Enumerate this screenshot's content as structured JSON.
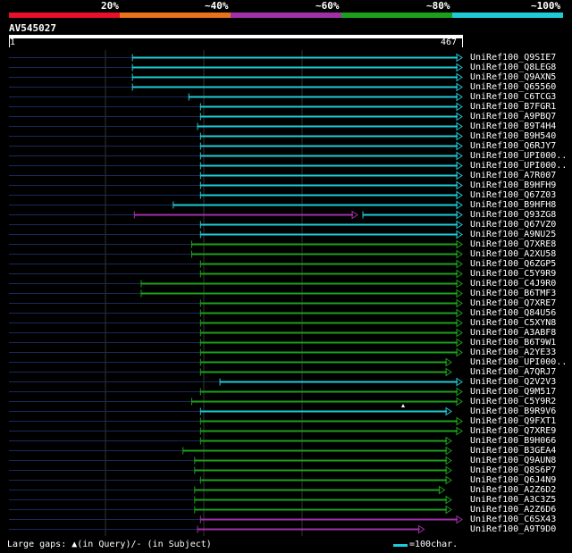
{
  "header": {
    "percent_labels": [
      "20%",
      "~40%",
      "~60%",
      "~80%",
      "~100%"
    ],
    "color_scale": [
      "#e8102a",
      "#e8731a",
      "#a030a8",
      "#1ca01c",
      "#1ecbd6"
    ]
  },
  "query": {
    "title": "AV545027",
    "start": "1",
    "end": "467"
  },
  "footer": {
    "legend": "Large gaps: ▲(in Query)/- (in Subject)",
    "scale_label": "=100char."
  },
  "hits": [
    {
      "label": "UniRef100_Q9SIE7",
      "start": 128,
      "end": 467,
      "color": "cyan"
    },
    {
      "label": "UniRef100_Q8LEG8",
      "start": 128,
      "end": 467,
      "color": "cyan"
    },
    {
      "label": "UniRef100_Q9AXN5",
      "start": 128,
      "end": 467,
      "color": "cyan"
    },
    {
      "label": "UniRef100_Q65560",
      "start": 128,
      "end": 467,
      "color": "cyan"
    },
    {
      "label": "UniRef100_C6TCG3",
      "start": 186,
      "end": 467,
      "color": "cyan"
    },
    {
      "label": "UniRef100_B7FGR1",
      "start": 198,
      "end": 467,
      "color": "cyan"
    },
    {
      "label": "UniRef100_A9PBQ7",
      "start": 198,
      "end": 467,
      "color": "cyan"
    },
    {
      "label": "UniRef100_B9T4H4",
      "start": 195,
      "end": 467,
      "color": "cyan"
    },
    {
      "label": "UniRef100_B9H540",
      "start": 198,
      "end": 467,
      "color": "cyan"
    },
    {
      "label": "UniRef100_Q6RJY7",
      "start": 198,
      "end": 467,
      "color": "cyan"
    },
    {
      "label": "UniRef100_UPI000..",
      "start": 198,
      "end": 467,
      "color": "cyan"
    },
    {
      "label": "UniRef100_UPI000..",
      "start": 198,
      "end": 467,
      "color": "cyan"
    },
    {
      "label": "UniRef100_A7R007",
      "start": 198,
      "end": 467,
      "color": "cyan"
    },
    {
      "label": "UniRef100_B9HFH9",
      "start": 198,
      "end": 467,
      "color": "cyan"
    },
    {
      "label": "UniRef100_Q67Z03",
      "start": 198,
      "end": 467,
      "color": "cyan"
    },
    {
      "label": "UniRef100_B9HFH8",
      "start": 170,
      "end": 467,
      "color": "cyan"
    },
    {
      "label": "UniRef100_Q93ZG8",
      "start": 130,
      "end": 467,
      "color": "purple-cyan"
    },
    {
      "label": "UniRef100_Q67VZ0",
      "start": 198,
      "end": 467,
      "color": "cyan"
    },
    {
      "label": "UniRef100_A9NU25",
      "start": 198,
      "end": 467,
      "color": "cyan"
    },
    {
      "label": "UniRef100_Q7XRE8",
      "start": 189,
      "end": 467,
      "color": "green"
    },
    {
      "label": "UniRef100_A2XU58",
      "start": 189,
      "end": 467,
      "color": "green"
    },
    {
      "label": "UniRef100_Q6ZGP5",
      "start": 198,
      "end": 467,
      "color": "green"
    },
    {
      "label": "UniRef100_C5Y9R9",
      "start": 198,
      "end": 467,
      "color": "green"
    },
    {
      "label": "UniRef100_C4J9R0",
      "start": 137,
      "end": 467,
      "color": "green"
    },
    {
      "label": "UniRef100_B6TMF3",
      "start": 137,
      "end": 467,
      "color": "green"
    },
    {
      "label": "UniRef100_Q7XRE7",
      "start": 198,
      "end": 467,
      "color": "green"
    },
    {
      "label": "UniRef100_Q84U56",
      "start": 198,
      "end": 467,
      "color": "green"
    },
    {
      "label": "UniRef100_C5XYN8",
      "start": 198,
      "end": 467,
      "color": "green"
    },
    {
      "label": "UniRef100_A3ABF8",
      "start": 198,
      "end": 467,
      "color": "green"
    },
    {
      "label": "UniRef100_B6T9W1",
      "start": 198,
      "end": 467,
      "color": "green"
    },
    {
      "label": "UniRef100_A2YE33",
      "start": 198,
      "end": 467,
      "color": "green"
    },
    {
      "label": "UniRef100_UPI000..",
      "start": 198,
      "end": 456,
      "color": "green"
    },
    {
      "label": "UniRef100_A7QRJ7",
      "start": 198,
      "end": 456,
      "color": "green"
    },
    {
      "label": "UniRef100_Q2V2V3",
      "start": 218,
      "end": 467,
      "color": "cyan"
    },
    {
      "label": "UniRef100_Q9M517",
      "start": 198,
      "end": 467,
      "color": "green"
    },
    {
      "label": "UniRef100_C5Y9R2",
      "start": 189,
      "end": 467,
      "color": "green"
    },
    {
      "label": "UniRef100_B9R9V6",
      "start": 198,
      "end": 456,
      "color": "cyan"
    },
    {
      "label": "UniRef100_Q9FXT1",
      "start": 198,
      "end": 467,
      "color": "green"
    },
    {
      "label": "UniRef100_Q7XRE9",
      "start": 198,
      "end": 467,
      "color": "green"
    },
    {
      "label": "UniRef100_B9H066",
      "start": 198,
      "end": 456,
      "color": "green"
    },
    {
      "label": "UniRef100_B3GEA4",
      "start": 180,
      "end": 456,
      "color": "green"
    },
    {
      "label": "UniRef100_Q9AUN8",
      "start": 192,
      "end": 456,
      "color": "green"
    },
    {
      "label": "UniRef100_Q8S6P7",
      "start": 192,
      "end": 456,
      "color": "green"
    },
    {
      "label": "UniRef100_Q6J4N9",
      "start": 198,
      "end": 456,
      "color": "green"
    },
    {
      "label": "UniRef100_A2Z6D2",
      "start": 192,
      "end": 449,
      "color": "green"
    },
    {
      "label": "UniRef100_A3C3Z5",
      "start": 192,
      "end": 456,
      "color": "green"
    },
    {
      "label": "UniRef100_A2Z6D6",
      "start": 192,
      "end": 456,
      "color": "green"
    },
    {
      "label": "UniRef100_C6SX43",
      "start": 198,
      "end": 467,
      "color": "purple"
    },
    {
      "label": "UniRef100_A9T9D0",
      "start": 195,
      "end": 428,
      "color": "purple"
    }
  ]
}
